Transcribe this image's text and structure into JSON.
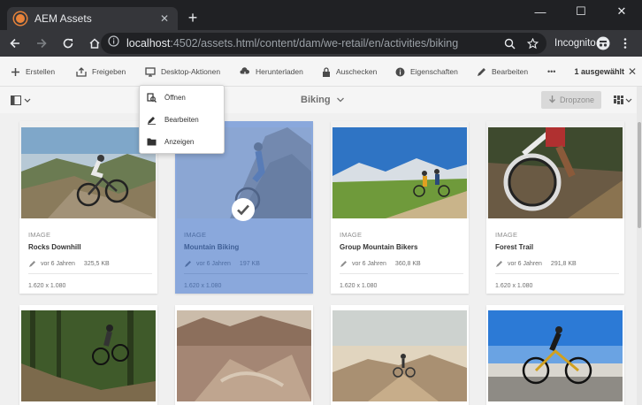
{
  "browser": {
    "tab_title": "AEM Assets",
    "url_host": "localhost",
    "url_rest": ":4502/assets.html/content/dam/we-retail/en/activities/biking",
    "incognito_label": "Incognito"
  },
  "actionbar": {
    "create": "Erstellen",
    "share": "Freigeben",
    "desktop_actions": "Desktop-Aktionen",
    "download": "Herunterladen",
    "checkout": "Auschecken",
    "properties": "Eigenschaften",
    "edit": "Bearbeiten",
    "more": "•••",
    "selected_count": "1 ausgewählt"
  },
  "secondbar": {
    "breadcrumb": "Biking",
    "dropzone": "Dropzone"
  },
  "popover": {
    "items": [
      {
        "label": "Öffnen",
        "icon": "open-icon"
      },
      {
        "label": "Bearbeiten",
        "icon": "edit-icon"
      },
      {
        "label": "Anzeigen",
        "icon": "folder-icon"
      }
    ]
  },
  "cards": [
    {
      "type": "IMAGE",
      "name": "Rocks Downhill",
      "modified": "vor 6 Jahren",
      "size": "325,5 KB",
      "dims": "1.620 x 1.080",
      "selected": false
    },
    {
      "type": "IMAGE",
      "name": "Mountain Biking",
      "modified": "vor 6 Jahren",
      "size": "197 KB",
      "dims": "1.620 x 1.080",
      "selected": true
    },
    {
      "type": "IMAGE",
      "name": "Group Mountain Bikers",
      "modified": "vor 6 Jahren",
      "size": "360,8 KB",
      "dims": "1.620 x 1.080",
      "selected": false
    },
    {
      "type": "IMAGE",
      "name": "Forest Trail",
      "modified": "vor 6 Jahren",
      "size": "291,8 KB",
      "dims": "1.620 x 1.080",
      "selected": false
    }
  ],
  "colors": {
    "selection": "#8aa8dc",
    "aem_bar": "#f5f5f5",
    "chrome_dark": "#202124"
  }
}
